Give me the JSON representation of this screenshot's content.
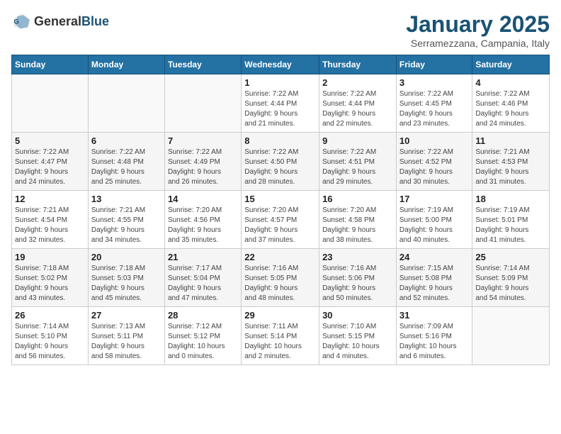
{
  "header": {
    "logo_general": "General",
    "logo_blue": "Blue",
    "title": "January 2025",
    "subtitle": "Serramezzana, Campania, Italy"
  },
  "weekdays": [
    "Sunday",
    "Monday",
    "Tuesday",
    "Wednesday",
    "Thursday",
    "Friday",
    "Saturday"
  ],
  "weeks": [
    [
      {
        "day": "",
        "detail": ""
      },
      {
        "day": "",
        "detail": ""
      },
      {
        "day": "",
        "detail": ""
      },
      {
        "day": "1",
        "detail": "Sunrise: 7:22 AM\nSunset: 4:44 PM\nDaylight: 9 hours\nand 21 minutes."
      },
      {
        "day": "2",
        "detail": "Sunrise: 7:22 AM\nSunset: 4:44 PM\nDaylight: 9 hours\nand 22 minutes."
      },
      {
        "day": "3",
        "detail": "Sunrise: 7:22 AM\nSunset: 4:45 PM\nDaylight: 9 hours\nand 23 minutes."
      },
      {
        "day": "4",
        "detail": "Sunrise: 7:22 AM\nSunset: 4:46 PM\nDaylight: 9 hours\nand 24 minutes."
      }
    ],
    [
      {
        "day": "5",
        "detail": "Sunrise: 7:22 AM\nSunset: 4:47 PM\nDaylight: 9 hours\nand 24 minutes."
      },
      {
        "day": "6",
        "detail": "Sunrise: 7:22 AM\nSunset: 4:48 PM\nDaylight: 9 hours\nand 25 minutes."
      },
      {
        "day": "7",
        "detail": "Sunrise: 7:22 AM\nSunset: 4:49 PM\nDaylight: 9 hours\nand 26 minutes."
      },
      {
        "day": "8",
        "detail": "Sunrise: 7:22 AM\nSunset: 4:50 PM\nDaylight: 9 hours\nand 28 minutes."
      },
      {
        "day": "9",
        "detail": "Sunrise: 7:22 AM\nSunset: 4:51 PM\nDaylight: 9 hours\nand 29 minutes."
      },
      {
        "day": "10",
        "detail": "Sunrise: 7:22 AM\nSunset: 4:52 PM\nDaylight: 9 hours\nand 30 minutes."
      },
      {
        "day": "11",
        "detail": "Sunrise: 7:21 AM\nSunset: 4:53 PM\nDaylight: 9 hours\nand 31 minutes."
      }
    ],
    [
      {
        "day": "12",
        "detail": "Sunrise: 7:21 AM\nSunset: 4:54 PM\nDaylight: 9 hours\nand 32 minutes."
      },
      {
        "day": "13",
        "detail": "Sunrise: 7:21 AM\nSunset: 4:55 PM\nDaylight: 9 hours\nand 34 minutes."
      },
      {
        "day": "14",
        "detail": "Sunrise: 7:20 AM\nSunset: 4:56 PM\nDaylight: 9 hours\nand 35 minutes."
      },
      {
        "day": "15",
        "detail": "Sunrise: 7:20 AM\nSunset: 4:57 PM\nDaylight: 9 hours\nand 37 minutes."
      },
      {
        "day": "16",
        "detail": "Sunrise: 7:20 AM\nSunset: 4:58 PM\nDaylight: 9 hours\nand 38 minutes."
      },
      {
        "day": "17",
        "detail": "Sunrise: 7:19 AM\nSunset: 5:00 PM\nDaylight: 9 hours\nand 40 minutes."
      },
      {
        "day": "18",
        "detail": "Sunrise: 7:19 AM\nSunset: 5:01 PM\nDaylight: 9 hours\nand 41 minutes."
      }
    ],
    [
      {
        "day": "19",
        "detail": "Sunrise: 7:18 AM\nSunset: 5:02 PM\nDaylight: 9 hours\nand 43 minutes."
      },
      {
        "day": "20",
        "detail": "Sunrise: 7:18 AM\nSunset: 5:03 PM\nDaylight: 9 hours\nand 45 minutes."
      },
      {
        "day": "21",
        "detail": "Sunrise: 7:17 AM\nSunset: 5:04 PM\nDaylight: 9 hours\nand 47 minutes."
      },
      {
        "day": "22",
        "detail": "Sunrise: 7:16 AM\nSunset: 5:05 PM\nDaylight: 9 hours\nand 48 minutes."
      },
      {
        "day": "23",
        "detail": "Sunrise: 7:16 AM\nSunset: 5:06 PM\nDaylight: 9 hours\nand 50 minutes."
      },
      {
        "day": "24",
        "detail": "Sunrise: 7:15 AM\nSunset: 5:08 PM\nDaylight: 9 hours\nand 52 minutes."
      },
      {
        "day": "25",
        "detail": "Sunrise: 7:14 AM\nSunset: 5:09 PM\nDaylight: 9 hours\nand 54 minutes."
      }
    ],
    [
      {
        "day": "26",
        "detail": "Sunrise: 7:14 AM\nSunset: 5:10 PM\nDaylight: 9 hours\nand 56 minutes."
      },
      {
        "day": "27",
        "detail": "Sunrise: 7:13 AM\nSunset: 5:11 PM\nDaylight: 9 hours\nand 58 minutes."
      },
      {
        "day": "28",
        "detail": "Sunrise: 7:12 AM\nSunset: 5:12 PM\nDaylight: 10 hours\nand 0 minutes."
      },
      {
        "day": "29",
        "detail": "Sunrise: 7:11 AM\nSunset: 5:14 PM\nDaylight: 10 hours\nand 2 minutes."
      },
      {
        "day": "30",
        "detail": "Sunrise: 7:10 AM\nSunset: 5:15 PM\nDaylight: 10 hours\nand 4 minutes."
      },
      {
        "day": "31",
        "detail": "Sunrise: 7:09 AM\nSunset: 5:16 PM\nDaylight: 10 hours\nand 6 minutes."
      },
      {
        "day": "",
        "detail": ""
      }
    ]
  ]
}
